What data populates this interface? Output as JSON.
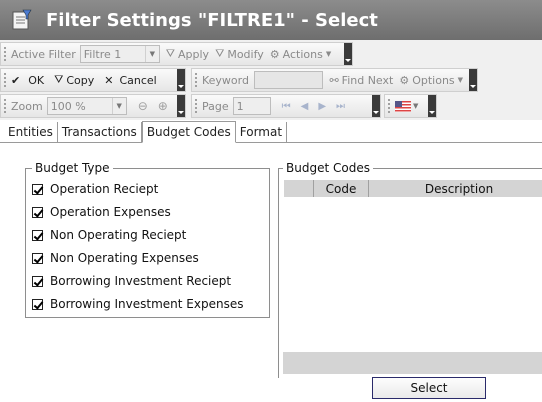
{
  "window": {
    "title": "Filter Settings \"FILTRE1\" - Select"
  },
  "toolbar1": {
    "active_filter_label": "Active Filter",
    "filter_value": "Filtre 1",
    "apply_label": "Apply",
    "modify_label": "Modify",
    "actions_label": "Actions"
  },
  "toolbar2": {
    "ok_label": "OK",
    "copy_label": "Copy",
    "cancel_label": "Cancel"
  },
  "toolbar3": {
    "keyword_label": "Keyword",
    "keyword_value": "",
    "find_next_label": "Find Next",
    "options_label": "Options"
  },
  "toolbar4": {
    "zoom_label": "Zoom",
    "zoom_value": "100 %"
  },
  "toolbar5": {
    "page_label": "Page",
    "page_value": "1"
  },
  "tabs": [
    {
      "label": "Entities"
    },
    {
      "label": "Transactions"
    },
    {
      "label": "Budget Codes"
    },
    {
      "label": "Format"
    }
  ],
  "budget_type": {
    "title": "Budget Type",
    "items": [
      {
        "label": "Operation Reciept",
        "checked": true
      },
      {
        "label": "Operation Expenses",
        "checked": true
      },
      {
        "label": "Non Operating Reciept",
        "checked": true
      },
      {
        "label": "Non Operating Expenses",
        "checked": true
      },
      {
        "label": "Borrowing Investment Reciept",
        "checked": true
      },
      {
        "label": "Borrowing Investment Expenses",
        "checked": true
      }
    ]
  },
  "budget_codes": {
    "title": "Budget Codes",
    "columns": [
      "Code",
      "Description"
    ],
    "rows": []
  },
  "select_button": {
    "label": "Select"
  }
}
